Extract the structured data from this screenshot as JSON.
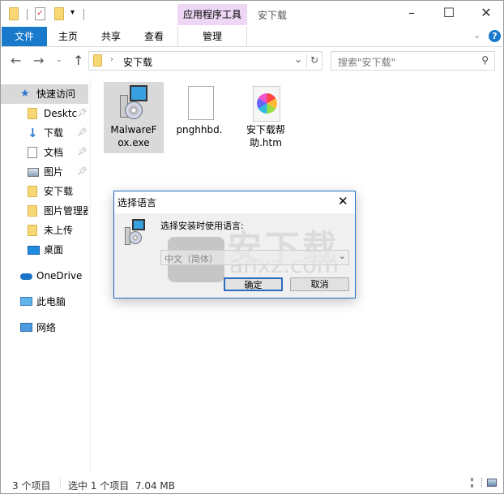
{
  "window": {
    "title": "安下载",
    "context_tab": "应用程序工具"
  },
  "ribbon": {
    "tabs": [
      {
        "label": "文件"
      },
      {
        "label": "主页"
      },
      {
        "label": "共享"
      },
      {
        "label": "查看"
      },
      {
        "label": "管理"
      }
    ]
  },
  "address": {
    "path": "安下载",
    "search_placeholder": "搜索\"安下载\""
  },
  "sidebar": {
    "items": [
      {
        "label": "快速访问",
        "icon": "star-icon"
      },
      {
        "label": "Desktc",
        "icon": "folder-icon",
        "pinned": true
      },
      {
        "label": "下载",
        "icon": "download-icon",
        "pinned": true
      },
      {
        "label": "文档",
        "icon": "document-icon",
        "pinned": true
      },
      {
        "label": "图片",
        "icon": "picture-icon",
        "pinned": true
      },
      {
        "label": "安下载",
        "icon": "folder-icon"
      },
      {
        "label": "图片管理器",
        "icon": "folder-icon"
      },
      {
        "label": "未上传",
        "icon": "folder-icon"
      },
      {
        "label": "桌面",
        "icon": "desktop-icon"
      },
      {
        "label": "OneDrive",
        "icon": "cloud-icon"
      },
      {
        "label": "此电脑",
        "icon": "computer-icon"
      },
      {
        "label": "网络",
        "icon": "network-icon"
      }
    ]
  },
  "files": [
    {
      "name": "MalwareFox.exe",
      "line1": "MalwareF",
      "line2": "ox.exe",
      "selected": true
    },
    {
      "name": "pnghhbd.",
      "line1": "pnghhbd.",
      "line2": ""
    },
    {
      "name": "安下载帮助.htm",
      "line1": "安下载帮",
      "line2": "助.htm"
    }
  ],
  "dialog": {
    "title": "选择语言",
    "prompt": "选择安装时使用语言:",
    "language": "中文（简体）",
    "ok": "确定",
    "cancel": "取消"
  },
  "watermark": {
    "text": "安下载",
    "url": "anxz.com"
  },
  "status": {
    "count": "3 个项目",
    "selected": "选中 1 个项目  7.04 MB"
  },
  "colors": {
    "accent": "#1979ca",
    "context_tab": "#eed7f4",
    "selection": "#d9d9d9"
  }
}
